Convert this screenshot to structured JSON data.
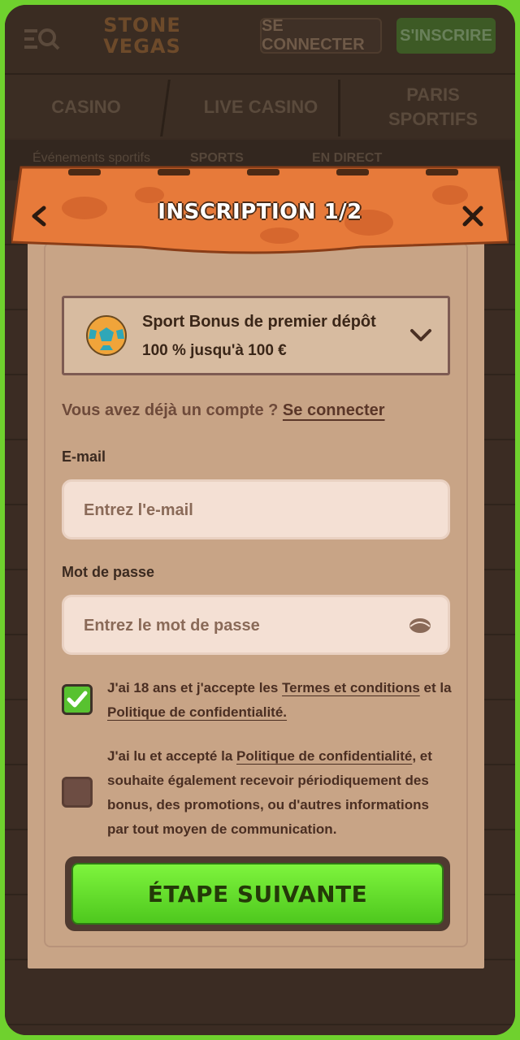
{
  "header": {
    "logo_text_1": "STONE",
    "logo_text_2": "VEGAS",
    "login_label": "SE CONNECTER",
    "signup_label": "S'INSCRIRE"
  },
  "nav": {
    "items": [
      {
        "label": "CASINO"
      },
      {
        "label": "LIVE CASINO"
      },
      {
        "label": "PARIS SPORTIFS"
      }
    ],
    "subnav": [
      "Événements sportifs",
      "SPORTS",
      "EN DIRECT"
    ]
  },
  "modal": {
    "title": "INSCRIPTION 1/2",
    "bonus": {
      "title": "Sport Bonus de premier dépôt",
      "subtitle": "100  % jusqu'à 100  €"
    },
    "have_account_text": "Vous avez déjà un compte ? ",
    "have_account_link": "Se connecter",
    "email": {
      "label": "E-mail",
      "placeholder": "Entrez l'e-mail"
    },
    "password": {
      "label": "Mot de passe",
      "placeholder": "Entrez le mot de passe"
    },
    "terms": {
      "checked": true,
      "text_1": "J'ai 18 ans et j'accepte les ",
      "link_1": "Termes et conditions",
      "text_2": " et la ",
      "link_2": "Politique de confidentialité."
    },
    "marketing": {
      "checked": false,
      "text_1": "J'ai lu et accepté la ",
      "link_1": "Politique de confidentialité",
      "text_2": ", et souhaite également recevoir périodiquement des bonus, des promotions, ou d'autres informations par tout moyen de communication."
    },
    "next_label": "ÉTAPE SUIVANTE"
  },
  "colors": {
    "frame_green": "#6fd12e",
    "awning_orange": "#e77a3a",
    "parchment": "#c8a486",
    "button_green": "#5fd62a"
  }
}
